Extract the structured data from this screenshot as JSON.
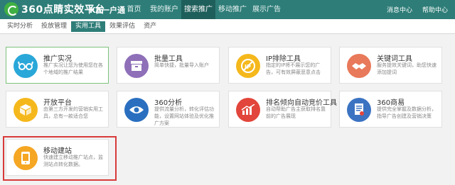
{
  "header": {
    "logo_text": "360点睛实效平台",
    "account": "KA一户通",
    "nav": [
      {
        "label": "首页"
      },
      {
        "label": "我的账户"
      },
      {
        "label": "搜索推广"
      },
      {
        "label": "移动推广"
      },
      {
        "label": "展示广告"
      }
    ],
    "messages": "消息中心",
    "help": "帮助中心"
  },
  "subnav": [
    {
      "label": "实时分析"
    },
    {
      "label": "投放管理"
    },
    {
      "label": "实用工具"
    },
    {
      "label": "效果评估"
    },
    {
      "label": "资产"
    }
  ],
  "tools": [
    {
      "title": "推广实况",
      "desc": "推广实况让您为使用您在各个地域的推广结果",
      "color": "#29a7d8",
      "icon": "glasses-icon"
    },
    {
      "title": "批量工具",
      "desc": "简单快捷，批量导入账户",
      "color": "#8e6fb8",
      "icon": "box-icon"
    },
    {
      "title": "IP排除工具",
      "desc": "指定的IP将不展示您的广告，可有效屏蔽恶意点击",
      "color": "#f5b81c",
      "icon": "ip-icon"
    },
    {
      "title": "关键词工具",
      "desc": "服务提效关键词，助您快速添加提词",
      "color": "#e8795a",
      "icon": "handshake-icon"
    },
    {
      "title": "开放平台",
      "desc": "由第三方开发的营销实用工具，总有一款适合您",
      "color": "#f5b81c",
      "icon": "cube-icon"
    },
    {
      "title": "360分析",
      "desc": "提供流量分析，转化评估功能，设置网站体验及优化推广方案",
      "color": "#2a6fbf",
      "icon": "eye-icon"
    },
    {
      "title": "排名倾向自动竞价工具",
      "desc": "自动帮助广告主获取排名靠前的广告展现",
      "color": "#e2453b",
      "icon": "chart-icon"
    },
    {
      "title": "360商易",
      "desc": "提供完全掌握及数据分析，指导广告创建及营销决策",
      "color": "#3b73c2",
      "icon": "document-icon"
    },
    {
      "title": "移动建站",
      "desc": "快速建立移动推广站点，监测站点转化数据。",
      "color": "#f5a623",
      "icon": "phone-icon"
    }
  ]
}
